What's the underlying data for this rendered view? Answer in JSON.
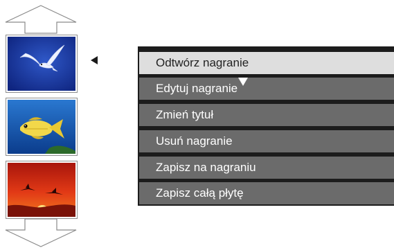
{
  "navigation": {
    "scroll_up_icon": "arrow-up-outline",
    "scroll_down_icon": "arrow-down-outline"
  },
  "thumbnails": [
    {
      "subject": "seagull-in-blue-sky",
      "background": "#1a3aa0"
    },
    {
      "subject": "yellow-fish-underwater",
      "background": "#1a5fb0"
    },
    {
      "subject": "sunset-with-birds",
      "background": "#c41c10"
    }
  ],
  "menu": {
    "items": [
      {
        "label": "Odtwórz nagranie",
        "selected": true
      },
      {
        "label": "Edytuj nagranie",
        "selected": false
      },
      {
        "label": "Zmień tytuł",
        "selected": false
      },
      {
        "label": "Usuń nagranie",
        "selected": false
      },
      {
        "label": "Zapisz na nagraniu",
        "selected": false
      },
      {
        "label": "Zapisz całą płytę",
        "selected": false
      }
    ]
  },
  "colors": {
    "menu_item_bg": "#6b6b6b",
    "menu_selected_bg": "#dedede",
    "menu_frame": "#1c1c1c",
    "pointer": "#1a1a1a"
  }
}
